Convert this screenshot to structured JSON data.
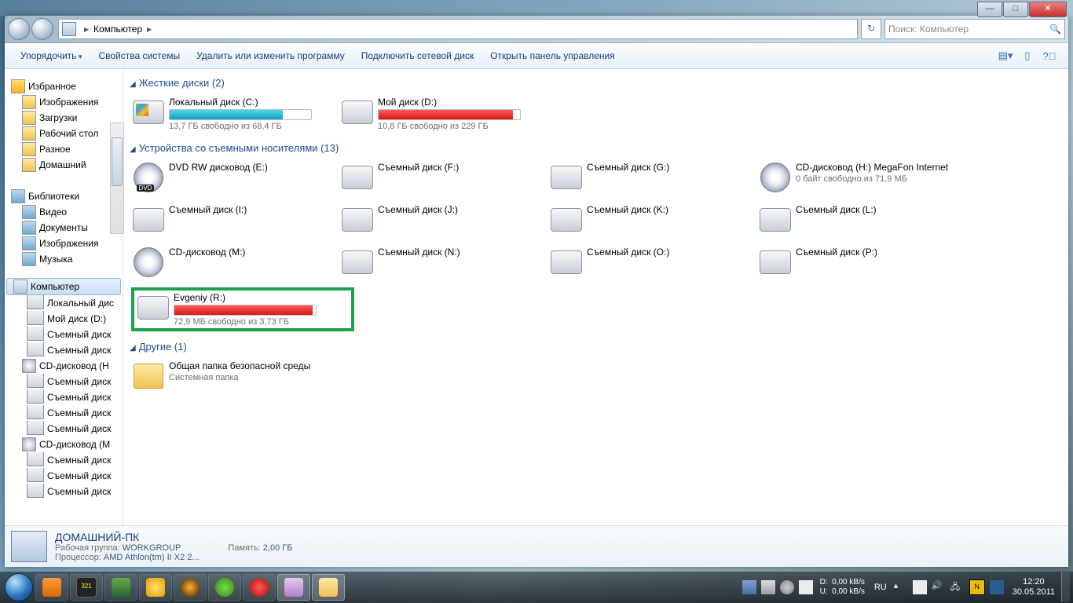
{
  "window_controls": {
    "min": "—",
    "max": "□",
    "close": "✕"
  },
  "address": {
    "location": "Компьютер",
    "separator": "▸",
    "refresh": "↻",
    "search_placeholder": "Поиск: Компьютер"
  },
  "toolbar": {
    "organize": "Упорядочить",
    "props": "Свойства системы",
    "uninstall": "Удалить или изменить программу",
    "netdrive": "Подключить сетевой диск",
    "ctrlpanel": "Открыть панель управления"
  },
  "sidebar": {
    "fav": "Избранное",
    "fav_items": [
      "Изображения",
      "Загрузки",
      "Рабочий стол",
      "Разное",
      "Домашний"
    ],
    "lib": "Библиотеки",
    "lib_items": [
      "Видео",
      "Документы",
      "Изображения",
      "Музыка"
    ],
    "computer": "Компьютер",
    "comp_items": [
      "Локальный дис",
      "Мой диск (D:)",
      "Съемный диск",
      "Съемный диск",
      "CD-дисковод (H",
      "Съемный диск",
      "Съемный диск",
      "Съемный диск",
      "Съемный диск",
      "CD-дисковод (M",
      "Съемный диск",
      "Съемный диск",
      "Съемный диск"
    ]
  },
  "groups": {
    "hdd": "Жесткие диски (2)",
    "removable": "Устройства со съемными носителями (13)",
    "other": "Другие (1)"
  },
  "hdd": [
    {
      "name": "Локальный диск (C:)",
      "sub": "13,7 ГБ свободно из 68,4 ГБ",
      "fill": 80,
      "color": "teal",
      "icon": "win"
    },
    {
      "name": "Мой диск (D:)",
      "sub": "10,8 ГБ свободно из 229 ГБ",
      "fill": 95,
      "color": "red",
      "icon": "disk"
    }
  ],
  "removable": [
    {
      "name": "DVD RW дисковод (E:)",
      "icon": "dvd"
    },
    {
      "name": "Съемный диск (F:)",
      "icon": "disk"
    },
    {
      "name": "Съемный диск (G:)",
      "icon": "disk"
    },
    {
      "name": "CD-дисковод (H:) MegaFon Internet",
      "sub": "0 байт свободно из 71,9 МБ",
      "icon": "cd"
    },
    {
      "name": "Съемный диск (I:)",
      "icon": "disk"
    },
    {
      "name": "Съемный диск (J:)",
      "icon": "disk"
    },
    {
      "name": "Съемный диск (K:)",
      "icon": "disk"
    },
    {
      "name": "Съемный диск (L:)",
      "icon": "disk"
    },
    {
      "name": "CD-дисковод (M:)",
      "icon": "cd"
    },
    {
      "name": "Съемный диск (N:)",
      "icon": "disk"
    },
    {
      "name": "Съемный диск (O:)",
      "icon": "disk"
    },
    {
      "name": "Съемный диск (P:)",
      "icon": "disk"
    },
    {
      "name": "Evgeniy (R:)",
      "sub": "72,9 МБ свободно из 3,73 ГБ",
      "fill": 98,
      "color": "red",
      "icon": "disk",
      "highlight": true
    }
  ],
  "other": [
    {
      "name": "Общая папка безопасной среды",
      "sub": "Системная папка",
      "icon": "folder"
    }
  ],
  "details": {
    "name": "ДОМАШНИЙ-ПК",
    "workgroup_l": "Рабочая группа:",
    "workgroup_v": "WORKGROUP",
    "cpu_l": "Процессор:",
    "cpu_v": "AMD Athlon(tm) II X2 2...",
    "mem_l": "Память:",
    "mem_v": "2,00 ГБ"
  },
  "tray": {
    "speed": {
      "d_l": "D:",
      "d_v": "0,00 kB/s",
      "u_l": "U:",
      "u_v": "0,00 kB/s"
    },
    "lang": "RU",
    "time": "12:20",
    "date": "30.05.2011"
  }
}
